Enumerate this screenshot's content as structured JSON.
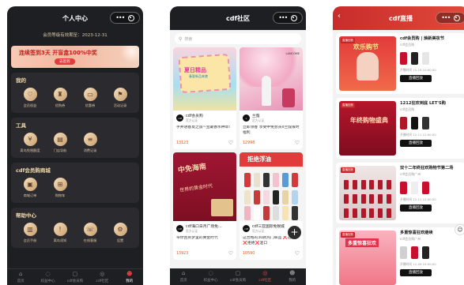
{
  "phone1": {
    "title": "个人中心",
    "member_valid": "会员等级有效期至：2023-12-31",
    "sign_banner": {
      "text": "连续签到3天 开盲盒100%中奖",
      "button": "去签到"
    },
    "sections": [
      {
        "title": "我的",
        "items": [
          {
            "icon": "gift-icon",
            "label": "会员权益"
          },
          {
            "icon": "bag-icon",
            "label": "优购券"
          },
          {
            "icon": "coupon-icon",
            "label": "优惠券"
          },
          {
            "icon": "flag-icon",
            "label": "活动记录"
          }
        ]
      },
      {
        "title": "工具",
        "items": [
          {
            "icon": "tax-icon",
            "label": "离岛免税额度"
          },
          {
            "icon": "store-icon",
            "label": "门店导航"
          },
          {
            "icon": "record-icon",
            "label": "消费记录"
          }
        ]
      },
      {
        "title": "cdf会员购商城",
        "items": [
          {
            "icon": "order-icon",
            "label": "商城订单"
          },
          {
            "icon": "cart-icon",
            "label": "购物车"
          }
        ]
      },
      {
        "title": "帮助中心",
        "items": [
          {
            "icon": "manual-icon",
            "label": "会员手册"
          },
          {
            "icon": "notice-icon",
            "label": "离岛须知"
          },
          {
            "icon": "service-icon",
            "label": "在线客服"
          },
          {
            "icon": "settings-icon",
            "label": "设置"
          }
        ]
      }
    ],
    "tabs": [
      {
        "icon": "⌂",
        "label": "首页"
      },
      {
        "icon": "◌",
        "label": "权益中心"
      },
      {
        "icon": "▢",
        "label": "cdf会员购"
      },
      {
        "icon": "◎",
        "label": "cdf社区"
      },
      {
        "icon": "☻",
        "label": "我的"
      }
    ]
  },
  "phone2": {
    "title": "cdf社区",
    "search_placeholder": "搜索",
    "posts": [
      {
        "author": "cdf会员购",
        "verify": "官方认证",
        "text": "手并进春夏之旅~宝藏香水种草!",
        "likes": "13123"
      },
      {
        "author": "兰蔻",
        "verify": "官方认证",
        "text": "立即领春 享受中免会员x兰蔻限时福利",
        "likes": "12998"
      },
      {
        "author": "cdf海口日月广场免…",
        "verify": "官方认证",
        "text": "带你回到梦里的黄金时代",
        "likes": "13923"
      },
      {
        "author": "cdf三亚国际免税城",
        "verify": "官方认证",
        "text": "这合格的30款热门单品 ❌这成❌拒绝❌混口",
        "likes": "10590"
      }
    ],
    "image_text": {
      "img1_main": "夏日精品",
      "img1_sub": "春夏新品来袭",
      "img2_brand": "LANCOME",
      "img3_main": "中免海南",
      "img3_sub": "世界的黄金时代",
      "img4_head": "拒绝浮油"
    },
    "tabs": [
      {
        "icon": "⌂",
        "label": "首页"
      },
      {
        "icon": "◌",
        "label": "权益中心"
      },
      {
        "icon": "▢",
        "label": "cdf会员购"
      },
      {
        "icon": "◎",
        "label": "cdf社区"
      },
      {
        "icon": "☻",
        "label": "我的"
      }
    ]
  },
  "phone3": {
    "title": "cdf直播",
    "lives": [
      {
        "tag": "直播回放",
        "banner": "欢乐购节",
        "title": "cdf会员购 | 焕新美妆节",
        "sub": "cdf会员购",
        "time": "开播时间 12-19 10:00:00",
        "button": "直播回放"
      },
      {
        "tag": "直播回放",
        "banner": "年终购物盛典",
        "title": "1212狂欢到底 LET'S购",
        "sub": "cdf会员购",
        "time": "开播时间 12-11 12:00:00",
        "button": "直播回放"
      },
      {
        "tag": "直播回放",
        "banner": "",
        "title": "双十二年终狂欢购物节第二场",
        "sub": "cdf会员购广州",
        "time": "开播时间 12-11 12:00:00",
        "button": "直播回放"
      },
      {
        "tag": "直播回放",
        "banner": "多重惊喜狂欢",
        "title": "多重惊喜狂欢继续",
        "sub": "cdf会员购广州",
        "time": "开播时间 12-09 19:00:00",
        "button": "直播回放"
      }
    ]
  },
  "colors": {
    "brand_red": "#e23b3b",
    "gold": "#f0d7a9",
    "dark": "#1e1f23"
  }
}
